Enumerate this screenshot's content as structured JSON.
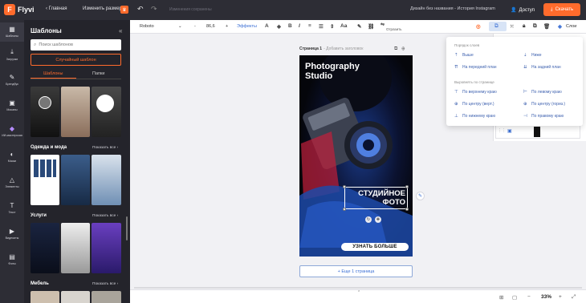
{
  "app": {
    "logo_text": "Flyvi",
    "logo_mark": "F",
    "home_label": "Главная",
    "resize_label": "Изменить размер",
    "status_text": "Изменения сохранены",
    "doc_name": "Дизайн без названия - История Instagram",
    "access_label": "Доступ",
    "download_label": "Скачать",
    "brand_color": "#ff6b2c"
  },
  "rail": [
    {
      "icon": "templates-icon",
      "glyph": "▦",
      "label": "Шаблоны"
    },
    {
      "icon": "upload-icon",
      "glyph": "⤓",
      "label": "Загрузки"
    },
    {
      "icon": "brandbook-icon",
      "glyph": "✎",
      "label": "Брендбук"
    },
    {
      "icon": "mockups-icon",
      "glyph": "▣",
      "label": "Мокапы"
    },
    {
      "icon": "ai-icon",
      "glyph": "◆",
      "label": "ИИ-мастерская"
    },
    {
      "icon": "masks-icon",
      "glyph": "◐",
      "label": "Маски"
    },
    {
      "icon": "elements-icon",
      "glyph": "△",
      "label": "Элементы"
    },
    {
      "icon": "text-icon",
      "glyph": "T",
      "label": "Текст"
    },
    {
      "icon": "video-icon",
      "glyph": "▶",
      "label": "Видеоиты"
    },
    {
      "icon": "background-icon",
      "glyph": "▤",
      "label": "Фоны"
    }
  ],
  "panel": {
    "title": "Шаблоны",
    "search_placeholder": "Поиск шаблонов",
    "random_button": "Случайный шаблон",
    "tabs": [
      "Шаблоны",
      "Папки"
    ],
    "sections": [
      {
        "title": "Одежда и мода",
        "show_all": "Показать все"
      },
      {
        "title": "Услуги",
        "show_all": "Показать все"
      },
      {
        "title": "Мебель",
        "show_all": "Показать все"
      }
    ]
  },
  "toolbar": {
    "font": "Roboto",
    "minus": "-",
    "size": "86,6",
    "plus": "+",
    "effects": "Эффекты",
    "mirror": "Отразить",
    "layers": "Слои"
  },
  "canvas": {
    "page_label": "Страница 1",
    "page_sub": "- Добавить заголовок",
    "design_title_line1": "Photography",
    "design_title_line2": "Studio",
    "studio_line1": "СТУДИЙНОЕ",
    "studio_line2": "ФОТО",
    "cta": "УЗНАТЬ БОЛЬШЕ",
    "add_page": "+ Еще 1 страница"
  },
  "dropdown": {
    "order_header": "Порядок слоев",
    "order_items": [
      {
        "icon": "arrow-up-icon",
        "glyph": "⇡",
        "label": "Выше"
      },
      {
        "icon": "arrow-down-icon",
        "glyph": "⇣",
        "label": "Ниже"
      },
      {
        "icon": "to-front-icon",
        "glyph": "⇈",
        "label": "На передний план"
      },
      {
        "icon": "to-back-icon",
        "glyph": "⇊",
        "label": "На задний план"
      }
    ],
    "align_header": "Выровнять по странице",
    "align_items": [
      {
        "icon": "align-top-icon",
        "glyph": "⊤",
        "label": "По верхнему краю"
      },
      {
        "icon": "align-left-icon",
        "glyph": "⊢",
        "label": "По левому краю"
      },
      {
        "icon": "align-vcenter-icon",
        "glyph": "⊕",
        "label": "По центру (верт.)"
      },
      {
        "icon": "align-hcenter-icon",
        "glyph": "⊕",
        "label": "По центру (гориз.)"
      },
      {
        "icon": "align-bottom-icon",
        "glyph": "⊥",
        "label": "По нижнему краю"
      },
      {
        "icon": "align-right-icon",
        "glyph": "⊣",
        "label": "По правому краю"
      }
    ]
  },
  "statusbar": {
    "zoom": "33%",
    "zoom_minus": "−",
    "zoom_plus": "+"
  }
}
